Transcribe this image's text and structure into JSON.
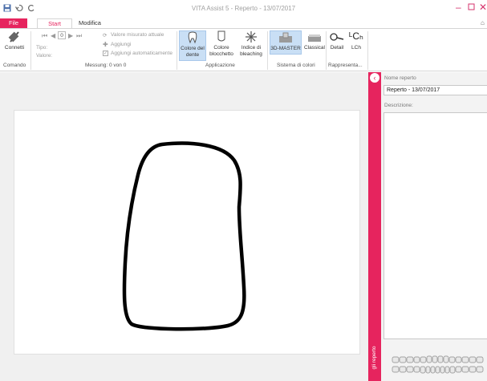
{
  "window": {
    "title": "VITA Assist 5 - Reperto - 13/07/2017"
  },
  "tabs": {
    "file": "File",
    "start": "Start",
    "modifica": "Modifica"
  },
  "ribbon": {
    "comando": {
      "connect_label": "Connetti",
      "group_label": "Comando"
    },
    "messung": {
      "nav_value": "0",
      "tipo_label": "Tipo:",
      "valore_label": "Valore:",
      "current_value_label": "Valore misurato attuale",
      "add_label": "Aggiungi",
      "auto_add_label": "Aggiungi automaticamente",
      "group_label": "Messung: 0 von 0"
    },
    "applicazione": {
      "tooth_color_label_1": "Colore del",
      "tooth_color_label_2": "dente",
      "block_color_label_1": "Colore",
      "block_color_label_2": "blocchetto",
      "bleaching_label_1": "Indice di",
      "bleaching_label_2": "bleaching",
      "group_label": "Applicazione"
    },
    "sistema": {
      "master_label": "3D-MASTER",
      "classical_label": "Classical",
      "group_label": "Sistema di colori"
    },
    "rappresentazione": {
      "detail_label": "Detail",
      "lch_label": "LCh",
      "lch_icon_text": "ᴸCₕ",
      "group_label": "Rappresenta..."
    }
  },
  "side_panel": {
    "vertical_label": "gli reperto",
    "name_label": "Nome reperto",
    "name_value": "Reperto - 13/07/2017",
    "desc_label": "Descrizione:"
  }
}
